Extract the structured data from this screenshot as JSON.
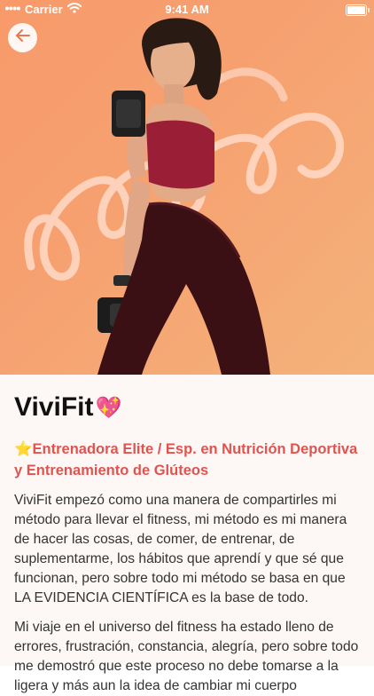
{
  "status_bar": {
    "carrier": "Carrier",
    "time": "9:41 AM"
  },
  "hero": {
    "background_color": "#f89a6a",
    "accent_outline": "#ffd8c8"
  },
  "profile": {
    "name": "ViviFit",
    "name_emoji": "💖",
    "subtitle_emoji": "⭐",
    "subtitle": "Entrenadora Elite / Esp. en Nutrición Deportiva y Entrenamiento de Glúteos",
    "paragraphs": [
      "ViviFit empezó como una manera de compartirles mi método para llevar el fitness, mi método es mi manera de hacer las cosas, de comer, de entrenar, de suplementarme, los hábitos que aprendí y que sé que funcionan, pero sobre todo mi método se basa en que LA EVIDENCIA CIENTÍFICA es la base de todo.",
      "Mi viaje en el universo del fitness ha estado lleno de errores, frustración, constancia, alegría, pero sobre todo me demostró que este proceso no debe tomarse a la ligera y más aun la idea de cambiar mi cuerpo"
    ]
  },
  "colors": {
    "subtitle": "#e2534f",
    "body_text": "#333333"
  },
  "icons": {
    "back": "arrow-left-icon",
    "wifi": "wifi-icon",
    "battery": "battery-icon"
  }
}
